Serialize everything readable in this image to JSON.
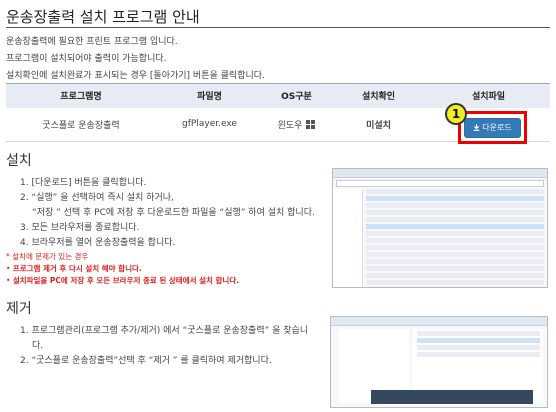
{
  "page_title": "운송장출력 설치 프로그램 안내",
  "intro_lines": [
    "운송장출력에 필요한 프린트 프로그램 입니다.",
    "프로그램이 설치되어야 출력이 가능합니다.",
    "설치확인에 설치완료가 표시되는 경우 [돌아가기] 버튼을 클릭합니다."
  ],
  "table": {
    "headers": [
      "프로그램명",
      "파일명",
      "OS구분",
      "설치확인",
      "설치파일"
    ],
    "row": {
      "program": "굿스플로 운송장출력",
      "file": "gfPlayer.exe",
      "os": "윈도우",
      "status": "미설치",
      "download_label": "다운로드"
    }
  },
  "badge_number": "1",
  "install": {
    "title": "설치",
    "steps": [
      "1. [다운로드] 버튼을 클릭합니다.",
      "2. “실행” 을 선택하여 즉시 설치 하거나,",
      "“저장 ” 선택 후 PC에 저장 후 다운로드한 파일을 “실행” 하여 설치 합니다.",
      "3. 모든 브라우저를 종료합니다.",
      "4. 브라우저를 열어 운송장출력을 합니다."
    ]
  },
  "warnings": [
    "설치에 문제가 있는 경우",
    "프로그램 제거 후 다시 설치 해야 합니다.",
    "설치파일을 PC에 저장 후 모든 브라우저 종료 된 상태에서 설치 합니다."
  ],
  "remove": {
    "title": "제거",
    "steps": [
      "1. 프로그램관리(프로그램 추가/제거) 에서 “굿스플로 운송장출력” 을 찾습니",
      "다.",
      "2. “굿스플로 운송장출력”선택 후 “제거 ” 를 클릭하여 제거합니다."
    ]
  },
  "colors": {
    "accent_button": "#337ab7",
    "status_red": "#e02020",
    "highlight_box": "#e00000",
    "badge": "#f2ec25"
  },
  "icons": [
    "download-icon",
    "windows-icon"
  ]
}
